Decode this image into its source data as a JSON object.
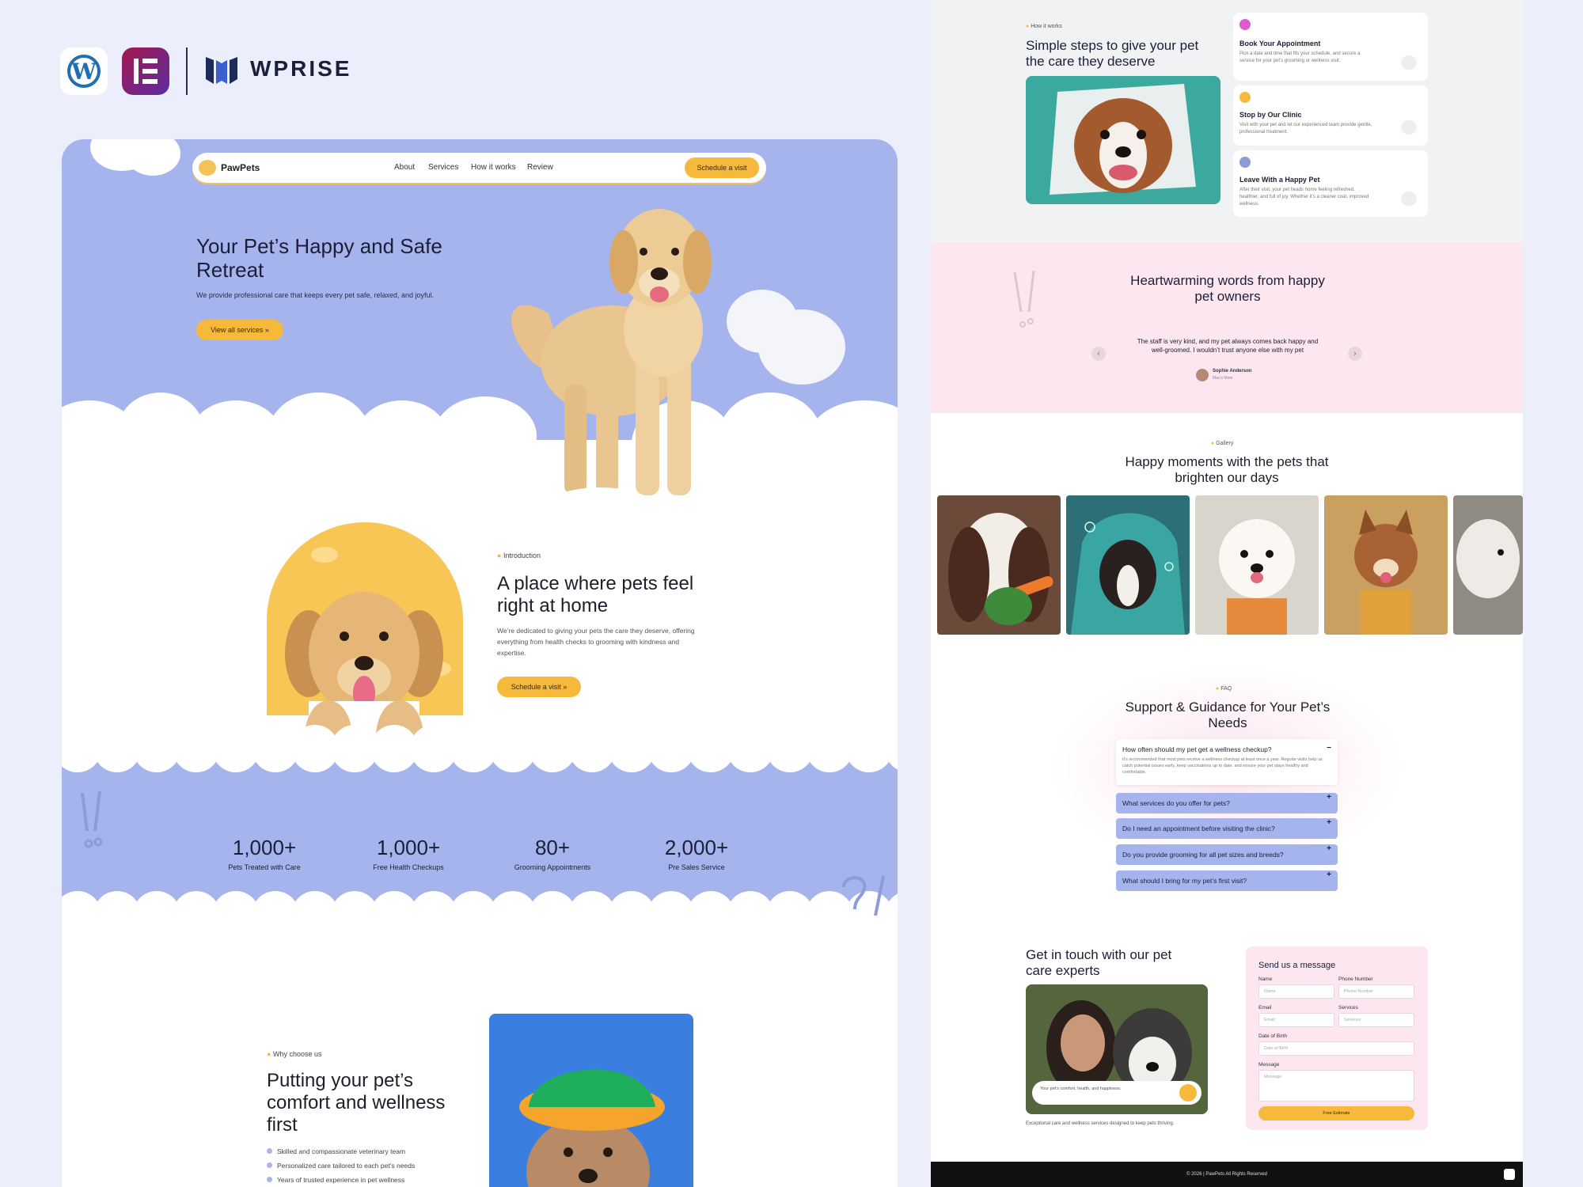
{
  "brand": {
    "name": "WPRISE",
    "icons": [
      "wordpress-icon",
      "elementor-icon"
    ]
  },
  "colors": {
    "periwinkle": "#a6b4ee",
    "yellow": "#f6b93b",
    "pink": "#fce7f1",
    "background": "#eceffb"
  },
  "nav": {
    "brand": "PawPets",
    "items": [
      "About",
      "Services",
      "How it works",
      "Review"
    ],
    "cta": "Schedule a visit"
  },
  "hero": {
    "title": "Your Pet’s Happy and Safe Retreat",
    "subtitle": "We provide professional care that keeps every pet safe, relaxed, and joyful.",
    "button": "View all services  »"
  },
  "intro": {
    "tag": "Introduction",
    "title": "A place where pets feel right at home",
    "text": "We’re dedicated to giving your pets the care they deserve, offering everything from health checks to grooming with kindness and expertise.",
    "button": "Schedule a visit  »"
  },
  "stats": [
    {
      "value": "1,000+",
      "label": "Pets Treated with Care"
    },
    {
      "value": "1,000+",
      "label": "Free Health Checkups"
    },
    {
      "value": "80+",
      "label": "Grooming Appointments"
    },
    {
      "value": "2,000+",
      "label": "Pre Sales Service"
    }
  ],
  "why": {
    "tag": "Why choose us",
    "title": "Putting your pet’s comfort and wellness first",
    "items": [
      "Skilled and compassionate veterinary team",
      "Personalized care tailored to each pet’s needs",
      "Years of trusted experience in pet wellness"
    ]
  },
  "how": {
    "tag": "How it works",
    "title": "Simple steps to give your pet the care they deserve",
    "steps": [
      {
        "title": "Book Your Appointment",
        "text": "Pick a date and time that fits your schedule, and secure a service for your pet’s grooming or wellness visit."
      },
      {
        "title": "Stop by Our Clinic",
        "text": "Visit with your pet and let our experienced team provide gentle, professional treatment."
      },
      {
        "title": "Leave With a Happy Pet",
        "text": "After their visit, your pet heads home feeling refreshed, healthier, and full of joy. Whether it’s a cleaner coat, improved wellness."
      }
    ]
  },
  "testimonial": {
    "title": "Heartwarming words from happy pet owners",
    "quote": "The staff is very kind, and my pet always comes back happy and well-groomed. I wouldn’t trust anyone else with my pet",
    "author": "Sophie Anderson",
    "role": "Max’s Mom"
  },
  "gallery": {
    "tag": "Gallery",
    "title": "Happy moments with the pets that brighten our days"
  },
  "faq": {
    "tag": "FAQ",
    "title": "Support & Guidance for Your Pet’s Needs",
    "open": {
      "q": "How often should my pet get a wellness checkup?",
      "a": "It’s recommended that most pets receive a wellness checkup at least once a year. Regular visits help us catch potential issues early, keep vaccinations up to date, and ensure your pet stays healthy and comfortable."
    },
    "items": [
      "What services do you offer for pets?",
      "Do I need an appointment before visiting the clinic?",
      "Do you provide grooming for all pet sizes and breeds?",
      "What should I bring for my pet’s first visit?"
    ]
  },
  "contact": {
    "title": "Get in touch with our pet care experts",
    "card_text": "Your pet’s comfort, health, and happiness.",
    "caption": "Exceptional care and wellness services designed to keep pets thriving.",
    "form_title": "Send us a message",
    "labels": {
      "name": "Name",
      "phone": "Phone Number",
      "email": "Email",
      "services": "Services",
      "dob": "Date of Birth",
      "message": "Message"
    },
    "placeholders": {
      "name": "Name",
      "phone": "Phone Number",
      "email": "Email",
      "services": "Services",
      "dob": "Date of Birth",
      "message": "Message"
    },
    "submit": "Free Estimate"
  },
  "footer": "© 2026 | PawPets All Rights Reserved"
}
